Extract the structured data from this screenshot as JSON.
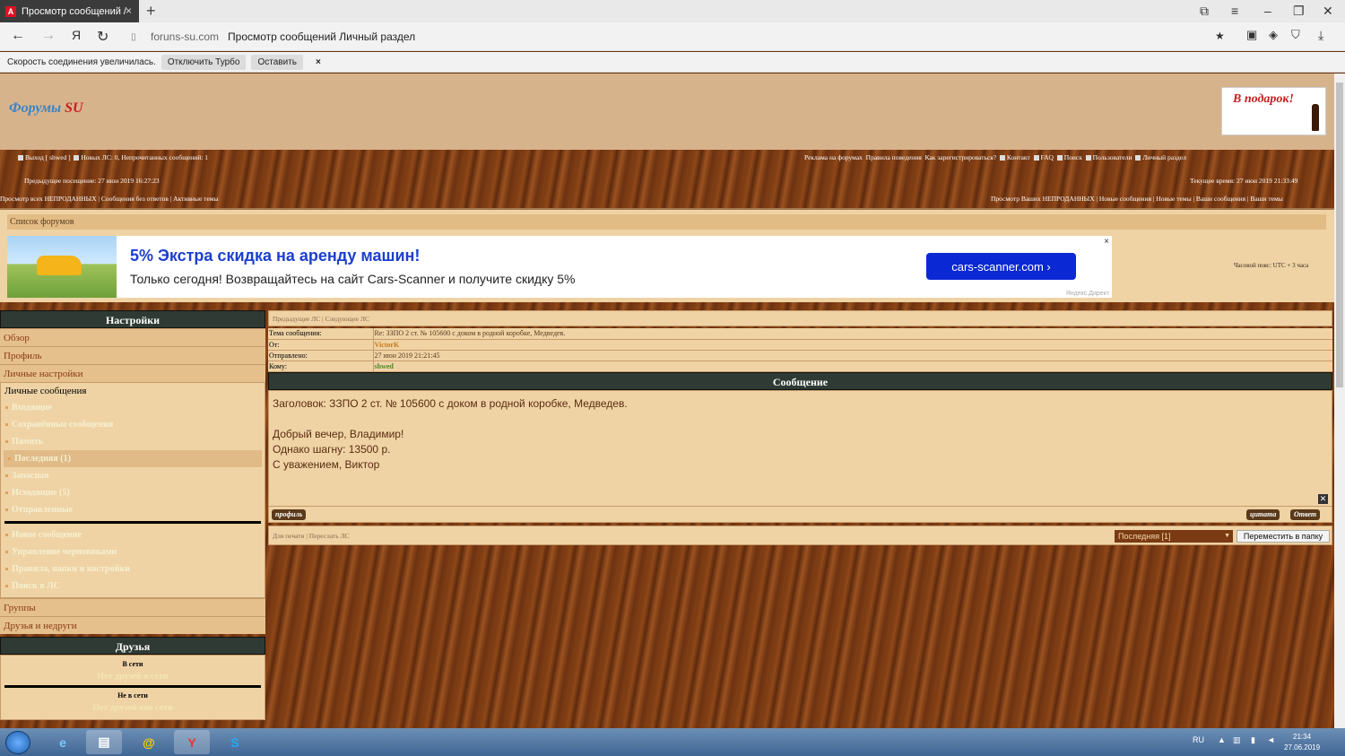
{
  "browser": {
    "tab_title": "Просмотр сообщений /",
    "tab_close": "×",
    "new_tab": "+",
    "domain": "foruns-su.com",
    "page_title": "Просмотр сообщений Личный раздел",
    "turbo_text": "Скорость соединения увеличилась.",
    "turbo_off": "Отключить Турбо",
    "turbo_keep": "Оставить",
    "turbo_close": "×"
  },
  "header": {
    "logo_main": "Форумы",
    "logo_su": "SU",
    "gift_text": "В подарок!"
  },
  "topbar": {
    "left_items": [
      "Выход [ shwed ]",
      "Новых ЛС: 0, Непрочитанных сообщений: 1"
    ],
    "right_items": [
      "Реклама на форумах",
      "Правила поведения",
      "Как зарегистрироваться?",
      "Контакт",
      "FAQ",
      "Поиск",
      "Пользователи",
      "Личный раздел"
    ],
    "last_visit": "Предыдущее посещение: 27 июн 2019 16:27:23",
    "current_time": "Текущее время: 27 июн 2019 21:33:49",
    "left_links": "Просмотр всех НЕПРОДАННЫХ | Сообщения без ответов | Активные темы",
    "right_links": "Просмотр Ваших НЕПРОДАННЫХ | Новые сообщения | Новые темы | Ваши сообщения | Ваши темы"
  },
  "forumlist": {
    "title": "Список форумов",
    "timezone": "Часовой пояс: UTC + 3 часа"
  },
  "ad": {
    "headline": "5% Экстра скидка на аренду машин!",
    "text": "Только сегодня! Возвращайтесь на сайт Cars-Scanner и получите скидку 5%",
    "button": "cars-scanner.com ›",
    "source": "Яндекс.Директ",
    "close": "×"
  },
  "left": {
    "settings_title": "Настройки",
    "sections": [
      "Обзор",
      "Профиль",
      "Личные настройки"
    ],
    "pm_title": "Личные сообщения",
    "pm_items": [
      "Входящие",
      "Сохранённые сообщения",
      "Память",
      "Последняя (1)",
      "Запасная",
      "Исходящие (5)",
      "Отправленные"
    ],
    "pm_items2": [
      "Новое сообщение",
      "Управление черновиками",
      "Правила, папки и настройки",
      "Поиск в ЛС"
    ],
    "sections2": [
      "Группы",
      "Друзья и недруги"
    ],
    "friends_title": "Друзья",
    "online_label": "В сети",
    "online_value": "Нет друзей в сети",
    "offline_label": "Не в сети",
    "offline_value": "Нет друзей вне сети"
  },
  "message": {
    "nav": "Предыдущее ЛС | Следующее ЛС",
    "meta": [
      {
        "k": "Тема сообщения:",
        "v": "Re: ЗЗПО 2 ст. № 105600 с доком в родной коробке, Медведев."
      },
      {
        "k": "От:",
        "v": "VictorK"
      },
      {
        "k": "Отправлено:",
        "v": "27 июн 2019 21:21:45"
      },
      {
        "k": "Кому:",
        "v": "shwed"
      }
    ],
    "head": "Сообщение",
    "subject_line": "Заголовок: ЗЗПО 2 ст. № 105600 с доком в родной коробке, Медведев.",
    "body": [
      "Добрый вечер, Владимир!",
      "Однако шагну: 13500 р.",
      "С уважением, Виктор"
    ],
    "btn_profile": "профиль",
    "btn_quote": "цитата",
    "btn_reply": "Ответ",
    "footer_links": "Для печати | Переслать ЛС",
    "folder_select": "Последняя [1]",
    "move_button": "Переместить в папку"
  },
  "taskbar": {
    "lang": "RU",
    "time": "21:34",
    "date": "27.06.2019"
  }
}
